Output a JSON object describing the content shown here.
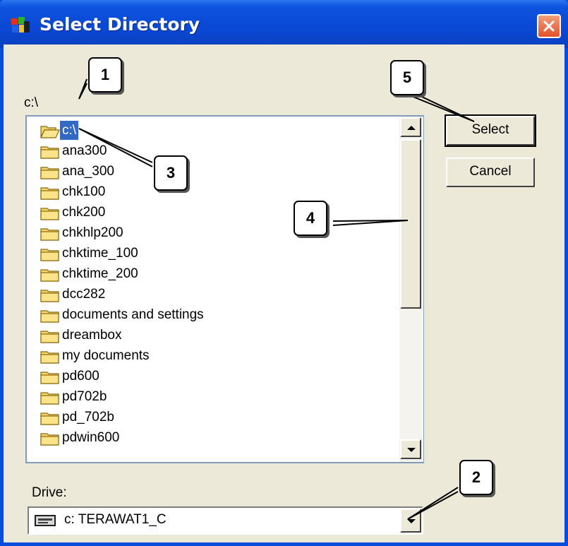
{
  "window": {
    "title": "Select Directory",
    "icon": "app-icon",
    "close_icon": "close-icon"
  },
  "path_label": "c:\\",
  "folders": [
    {
      "name": "c:\\",
      "open": true,
      "selected": true
    },
    {
      "name": "ana300"
    },
    {
      "name": "ana_300"
    },
    {
      "name": "chk100"
    },
    {
      "name": "chk200"
    },
    {
      "name": "chkhlp200"
    },
    {
      "name": "chktime_100"
    },
    {
      "name": "chktime_200"
    },
    {
      "name": "dcc282"
    },
    {
      "name": "documents and settings"
    },
    {
      "name": "dreambox"
    },
    {
      "name": "my documents"
    },
    {
      "name": "pd600"
    },
    {
      "name": "pd702b"
    },
    {
      "name": "pd_702b"
    },
    {
      "name": "pdwin600"
    }
  ],
  "buttons": {
    "select": "Select",
    "cancel": "Cancel"
  },
  "drive": {
    "label": "Drive:",
    "value": "c: TERAWAT1_C",
    "icon": "drive-icon"
  },
  "callouts": {
    "c1": "1",
    "c2": "2",
    "c3": "3",
    "c4": "4",
    "c5": "5"
  },
  "colors": {
    "title_bar": "#0a48d4",
    "selection": "#316ac5",
    "dialog_bg": "#ece9d8",
    "close_button": "#e2502a"
  }
}
